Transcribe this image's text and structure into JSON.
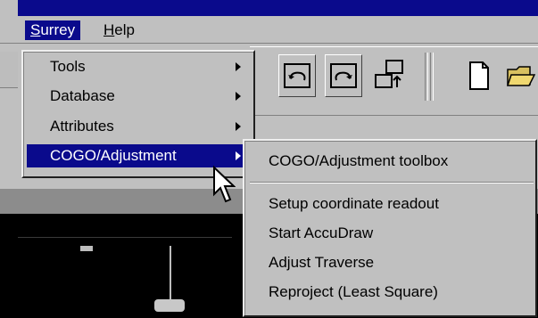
{
  "menubar": {
    "surrey_label_first": "S",
    "surrey_label_rest": "urrey",
    "help_label_first": "H",
    "help_label_rest": "elp"
  },
  "surrey_menu": {
    "items": [
      {
        "label": "Tools"
      },
      {
        "label": "Database"
      },
      {
        "label": "Attributes"
      },
      {
        "label": "COGO/Adjustment"
      }
    ]
  },
  "cogo_submenu": {
    "items": [
      {
        "label": "COGO/Adjustment toolbox"
      },
      {
        "label": "Setup coordinate readout"
      },
      {
        "label": "Start AccuDraw"
      },
      {
        "label": "Adjust Traverse"
      },
      {
        "label": "Reproject (Least Square)"
      }
    ]
  },
  "colors": {
    "menu_background": "#c0c0c0",
    "selection": "#0a0a8c",
    "canvas": "#000000"
  }
}
